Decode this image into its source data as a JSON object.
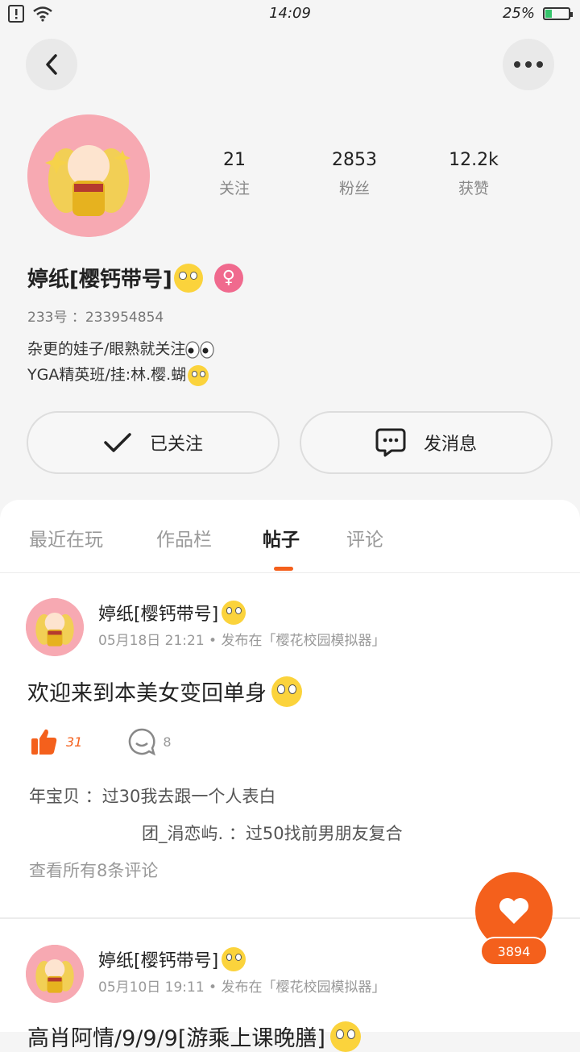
{
  "status_bar": {
    "time": "14:09",
    "battery": "25%"
  },
  "profile": {
    "stats": [
      {
        "value": "21",
        "label": "关注"
      },
      {
        "value": "2853",
        "label": "粉丝"
      },
      {
        "value": "12.2k",
        "label": "获赞"
      }
    ],
    "name": "婷纸[樱钙带号]",
    "uid": "233号 ：233954854",
    "bio_lines": [
      "杂更的娃子/眼熟就关注",
      "YGA精英班/挂:林.樱.蝴"
    ],
    "follow_label": "已关注",
    "message_label": "发消息"
  },
  "tabs": [
    "最近在玩",
    "作品栏",
    "帖子",
    "评论"
  ],
  "posts": [
    {
      "author": "婷纸[樱钙带号]",
      "meta": "05月18日 21:21 • 发布在「樱花校园模拟器」",
      "title": "欢迎来到本美女变回单身",
      "likes": "31",
      "comments": "8",
      "comment_lines": [
        "年宝贝 ：过30我去跟一个人表白",
        "团_涓恋屿. ：过50找前男朋友复合"
      ],
      "view_all": "查看所有8条评论"
    },
    {
      "author": "婷纸[樱钙带号]",
      "meta": "05月10日 19:11 • 发布在「樱花校园模拟器」",
      "title": "高肖阿情/9/9/9[游乘上课晚膳]"
    }
  ],
  "fab": {
    "count": "3894"
  },
  "colors": {
    "accent": "#f4601c",
    "gender": "#f06a8e"
  }
}
